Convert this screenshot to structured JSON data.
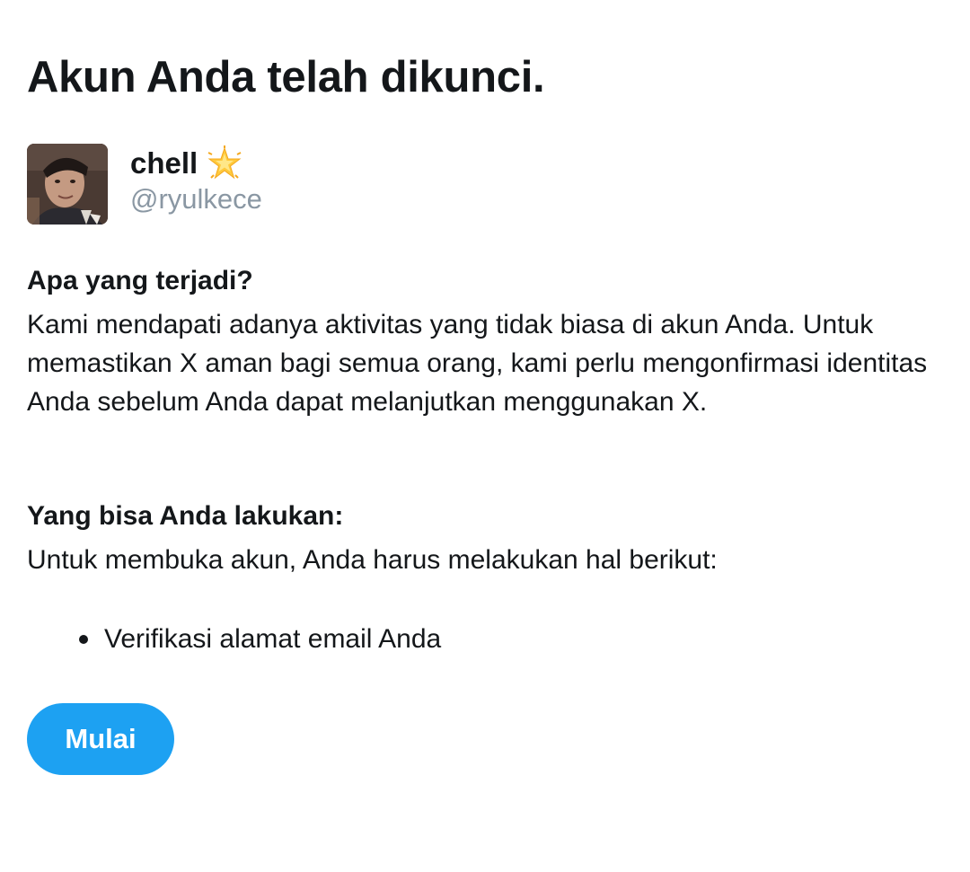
{
  "title": "Akun Anda telah dikunci.",
  "profile": {
    "display_name": "chell",
    "name_emoji_icon": "glowing-star-icon",
    "handle": "@ryulkece"
  },
  "what_happened": {
    "heading": "Apa yang terjadi?",
    "body": "Kami mendapati adanya aktivitas yang tidak biasa di akun Anda. Untuk memastikan X aman bagi semua orang, kami perlu mengonfirmasi identitas Anda sebelum Anda dapat melanjutkan menggunakan X."
  },
  "what_to_do": {
    "heading": "Yang bisa Anda lakukan:",
    "body": "Untuk membuka akun, Anda harus melakukan hal berikut:",
    "steps": [
      "Verifikasi alamat email Anda"
    ]
  },
  "start_button": {
    "label": "Mulai"
  },
  "colors": {
    "accent": "#1da1f2",
    "text": "#14171a",
    "muted": "#8a97a3"
  }
}
